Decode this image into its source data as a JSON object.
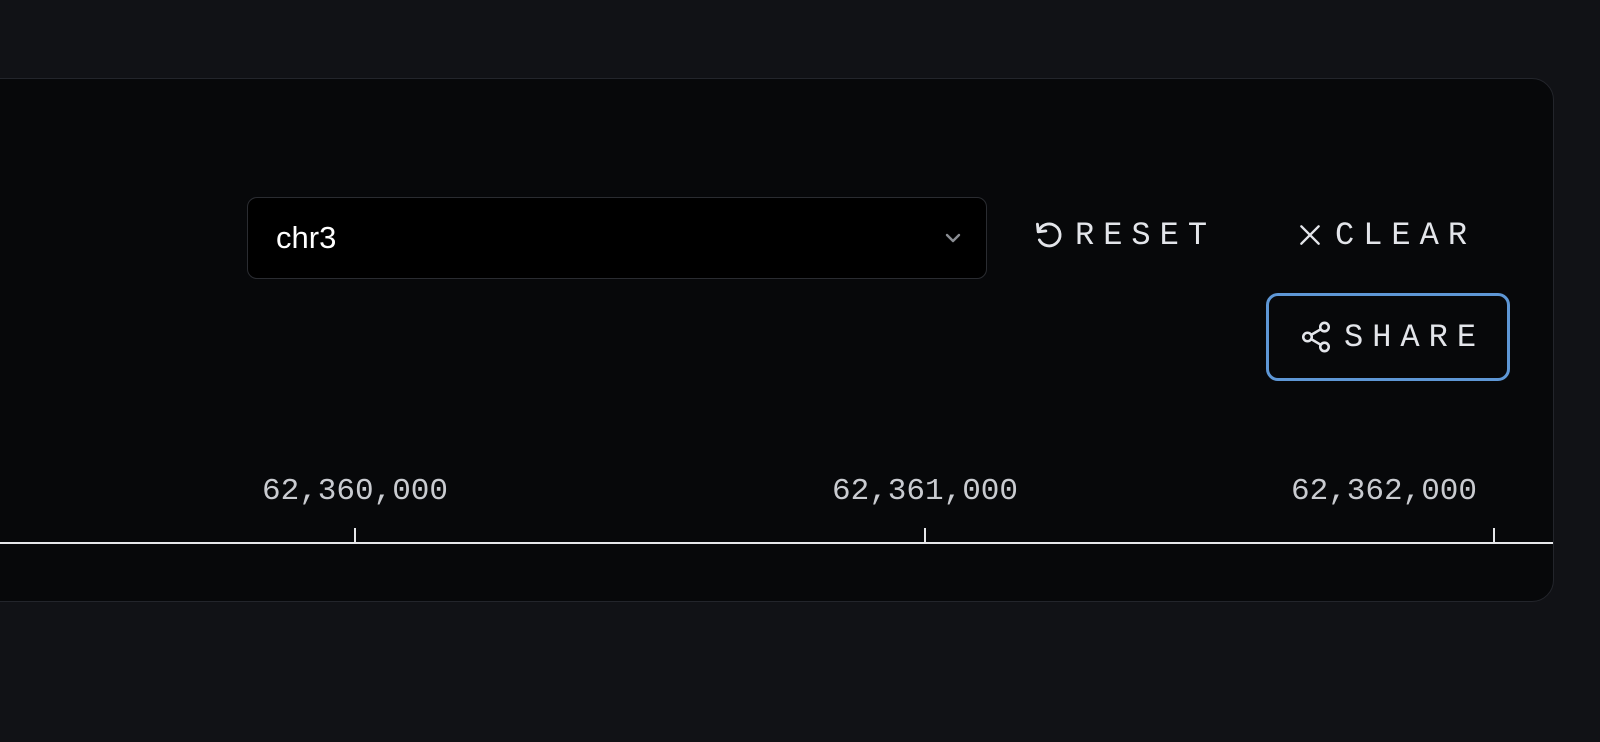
{
  "region": {
    "chromosome": "chr3"
  },
  "actions": {
    "reset_label": "RESET",
    "clear_label": "CLEAR",
    "share_label": "SHARE"
  },
  "axis": {
    "ticks": [
      {
        "label": "62,360,000",
        "position": 62360000
      },
      {
        "label": "62,361,000",
        "position": 62361000
      },
      {
        "label": "62,362,000",
        "position": 62362000
      }
    ]
  },
  "colors": {
    "panel_background": "#07080a",
    "page_background": "#111216",
    "share_accent": "#5e97d6",
    "text": "#e3e5ea"
  },
  "icons": {
    "reset": "reset-icon",
    "clear": "close-icon",
    "share": "share-icon",
    "select": "chevron-down-icon"
  }
}
